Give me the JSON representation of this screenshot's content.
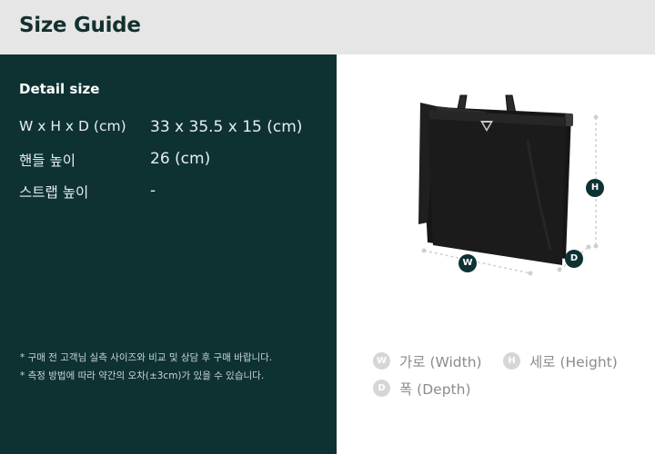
{
  "header": {
    "title": "Size Guide"
  },
  "detail": {
    "title": "Detail size",
    "specs": [
      {
        "label": "W x H x D (cm)",
        "value": "33 x 35.5 x 15 (cm)"
      },
      {
        "label": "핸들 높이",
        "value": "26 (cm)"
      },
      {
        "label": "스트랩 높이",
        "value": "-"
      }
    ],
    "notes": [
      "* 구매 전 고객님 실측 사이즈와 비교 및 상담 후 구매 바랍니다.",
      "* 측정 방법에 따라 약간의 오차(±3cm)가 있을 수 있습니다."
    ]
  },
  "diagram": {
    "badges": {
      "w": "W",
      "h": "H",
      "d": "D"
    }
  },
  "legend": [
    {
      "badge": "W",
      "label": "가로 (Width)"
    },
    {
      "badge": "H",
      "label": "세로 (Height)"
    },
    {
      "badge": "D",
      "label": "폭 (Depth)"
    }
  ],
  "colors": {
    "panel": "#0e3232",
    "header_bg": "#e6e6e6",
    "badge_dark": "#0e3232",
    "legend_badge": "#d6d6d6"
  },
  "icons": [
    "bag-product-image"
  ]
}
